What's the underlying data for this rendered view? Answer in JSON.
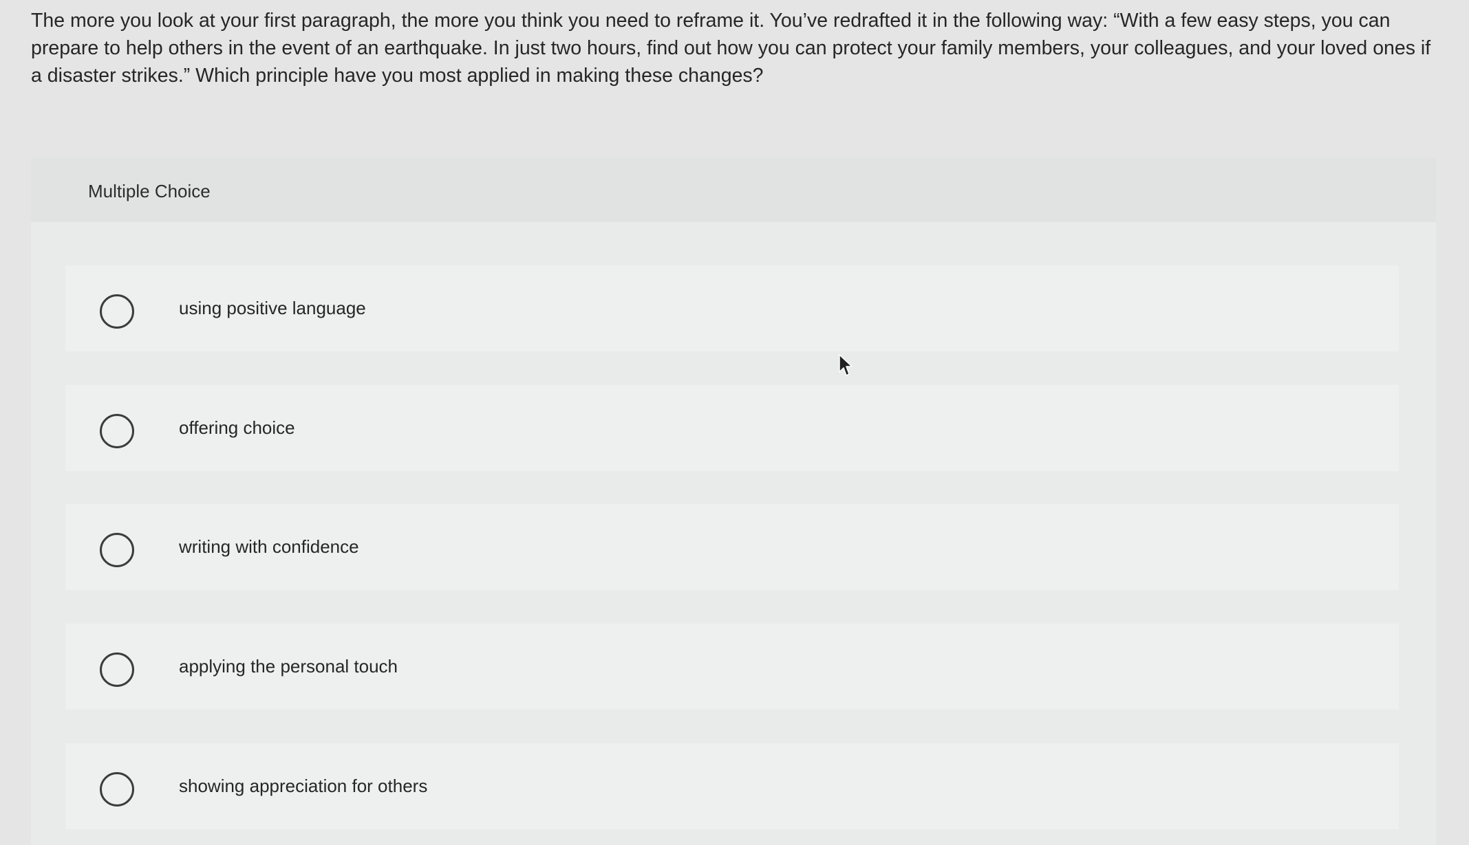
{
  "question": {
    "text": "The more you look at your first paragraph, the more you think you need to reframe it. You’ve redrafted it in the following way: “With a few easy steps, you can prepare to help others in the event of an earthquake. In just two hours, find out how you can protect your family members, your colleagues, and your loved ones if a disaster strikes.” Which principle have you most applied in making these changes?"
  },
  "panel": {
    "title": "Multiple Choice"
  },
  "options": [
    {
      "label": "using positive language",
      "selected": false
    },
    {
      "label": "offering choice",
      "selected": false
    },
    {
      "label": "writing with confidence",
      "selected": false
    },
    {
      "label": "applying the personal touch",
      "selected": false
    },
    {
      "label": "showing appreciation for others",
      "selected": false
    }
  ],
  "icons": {
    "radio": "radio-unselected-icon",
    "cursor": "mouse-pointer-icon"
  },
  "colors": {
    "background": "#e4e5e4",
    "panel": "#e9eaea",
    "option": "#eeefef",
    "text": "#262626",
    "radio_border": "#3c3c3c"
  }
}
